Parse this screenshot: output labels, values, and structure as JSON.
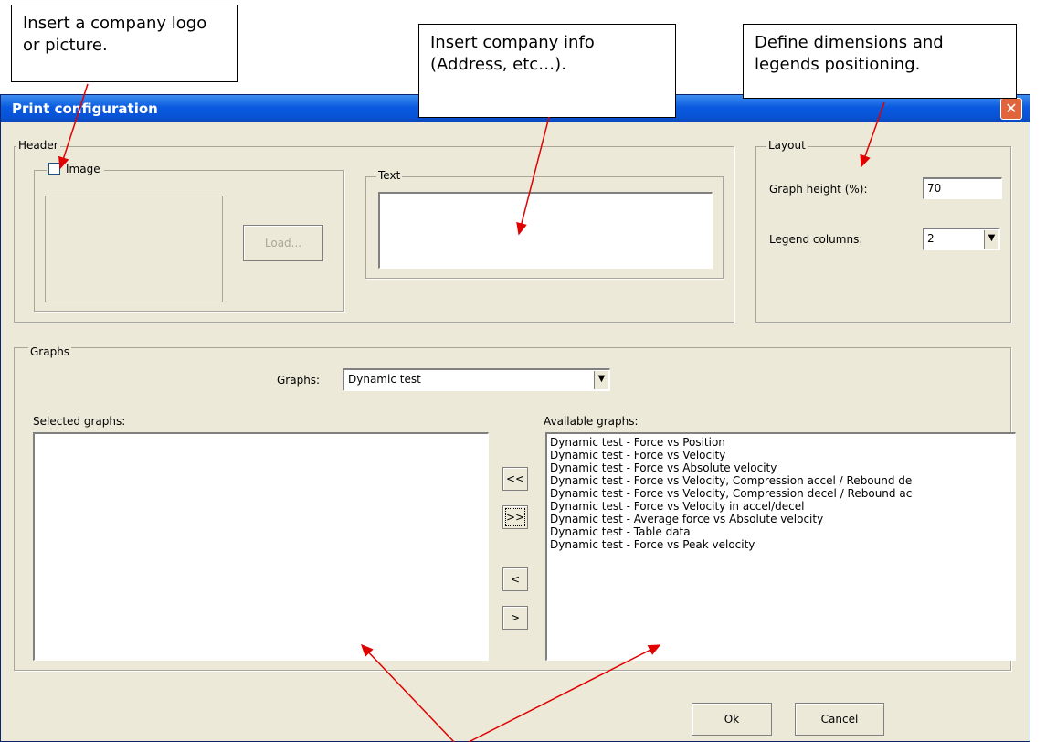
{
  "callouts": {
    "logo": "Insert a company logo or picture.",
    "info": "Insert company info (Address, etc…).",
    "layout": "Define dimensions and legends positioning."
  },
  "dialog": {
    "title": "Print configuration",
    "close_label": "✕",
    "header": {
      "label": "Header",
      "image_label": "Image",
      "image_checked": false,
      "load_button": "Load...",
      "text_label": "Text",
      "text_value": ""
    },
    "layout": {
      "label": "Layout",
      "graph_height_label": "Graph height (%):",
      "graph_height_value": "70",
      "legend_columns_label": "Legend columns:",
      "legend_columns_value": "2"
    },
    "graphs": {
      "label": "Graphs",
      "graphs_combo_label": "Graphs:",
      "graphs_combo_value": "Dynamic test",
      "selected_label": "Selected graphs:",
      "available_label": "Available graphs:",
      "selected_items": [],
      "available_items": [
        "Dynamic test - Force vs Position",
        "Dynamic test - Force vs Velocity",
        "Dynamic test - Force vs Absolute velocity",
        "Dynamic test - Force vs Velocity, Compression accel / Rebound de",
        "Dynamic test - Force vs Velocity, Compression decel / Rebound ac",
        "Dynamic test - Force vs Velocity in accel/decel",
        "Dynamic test - Average force vs Absolute velocity",
        "Dynamic test - Table data",
        "Dynamic test - Force vs Peak velocity"
      ],
      "move_all_left": "<<",
      "move_all_right": ">>",
      "move_left": "<",
      "move_right": ">"
    },
    "ok_button": "Ok",
    "cancel_button": "Cancel"
  },
  "colors": {
    "dialog_background": "#ece9d8",
    "titlebar": "#0a5ae0",
    "close_button": "#e0643c",
    "annotation_arrow": "#e00000"
  }
}
